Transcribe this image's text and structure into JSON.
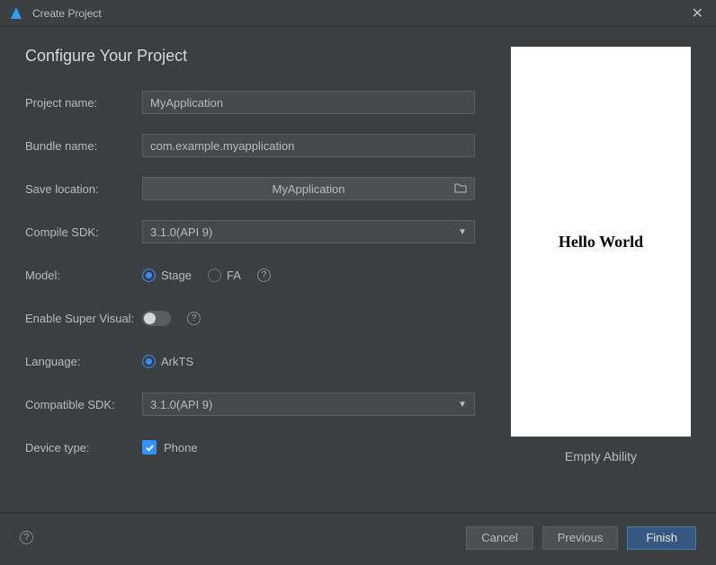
{
  "window": {
    "title": "Create Project"
  },
  "page": {
    "heading": "Configure Your Project"
  },
  "form": {
    "projectName": {
      "label": "Project name:",
      "value": "MyApplication"
    },
    "bundleName": {
      "label": "Bundle name:",
      "value": "com.example.myapplication"
    },
    "saveLocation": {
      "label": "Save location:",
      "value": "MyApplication"
    },
    "compileSdk": {
      "label": "Compile SDK:",
      "value": "3.1.0(API 9)"
    },
    "model": {
      "label": "Model:",
      "options": {
        "stage": "Stage",
        "fa": "FA"
      },
      "selected": "stage"
    },
    "enableSuperVisual": {
      "label": "Enable Super Visual:",
      "value": false
    },
    "language": {
      "label": "Language:",
      "options": {
        "arkts": "ArkTS"
      },
      "selected": "arkts"
    },
    "compatibleSdk": {
      "label": "Compatible SDK:",
      "value": "3.1.0(API 9)"
    },
    "deviceType": {
      "label": "Device type:",
      "options": {
        "phone": "Phone"
      },
      "checked": true
    }
  },
  "preview": {
    "text": "Hello World",
    "caption": "Empty Ability"
  },
  "footer": {
    "cancel": "Cancel",
    "previous": "Previous",
    "finish": "Finish"
  }
}
